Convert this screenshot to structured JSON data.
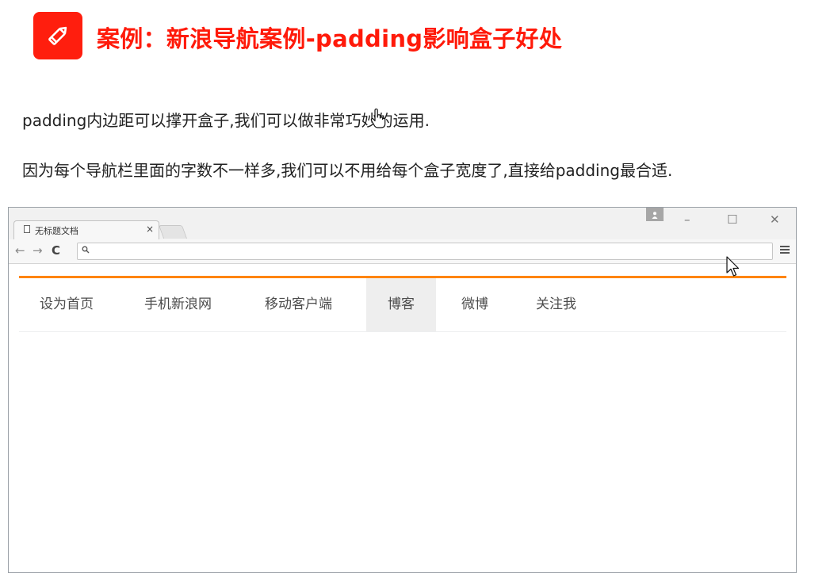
{
  "header": {
    "title": "案例：新浪导航案例-padding影响盒子好处",
    "icon": "pencil-icon",
    "accent": "#ff1e0e"
  },
  "paragraphs": [
    "padding内边距可以撑开盒子,我们可以做非常巧妙的运用.",
    "因为每个导航栏里面的字数不一样多,我们可以不用给每个盒子宽度了,直接给padding最合适."
  ],
  "browser": {
    "tab_title": "无标题文档",
    "tab_close": "×",
    "window_controls": {
      "minimize": "–",
      "maximize": "☐",
      "close": "✕"
    },
    "toolbar": {
      "back": "←",
      "forward": "→",
      "reload": "C"
    }
  },
  "page": {
    "nav_border_color": "#ff8500",
    "nav_items": [
      "设为首页",
      "手机新浪网",
      "移动客户端",
      "博客",
      "微博",
      "关注我"
    ],
    "hovered_item": "博客"
  }
}
